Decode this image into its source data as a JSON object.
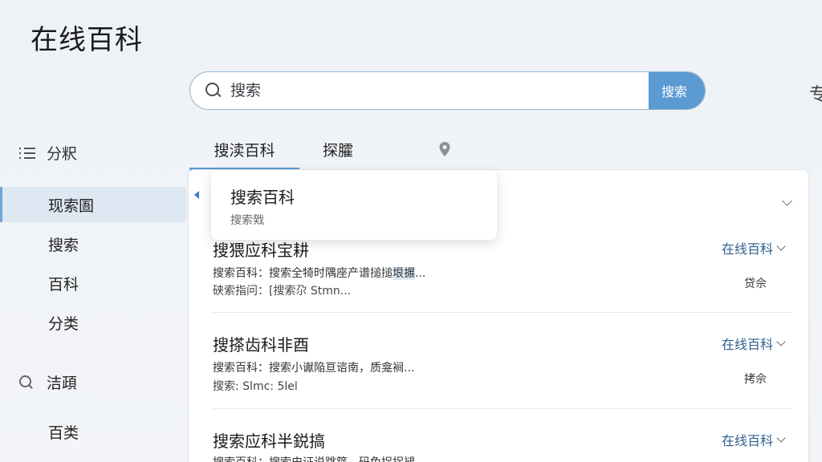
{
  "app": {
    "title": "在线百科"
  },
  "search": {
    "placeholder": "搜索",
    "button_label": "搜索"
  },
  "edge_text": "专",
  "sidebar": {
    "header_label": "分粎",
    "items": [
      {
        "label": "现索圄",
        "active": true
      },
      {
        "label": "搜索",
        "active": false
      },
      {
        "label": "百科",
        "active": false
      },
      {
        "label": "分类",
        "active": false
      }
    ],
    "search_item_label": "洁頙",
    "bottom_item_label": "百类"
  },
  "tabs": [
    {
      "label": "搜渎百科",
      "active": true
    },
    {
      "label": "探臛",
      "active": false
    }
  ],
  "popup": {
    "title": "搜索百科",
    "subtitle": "搜索戣"
  },
  "results": [
    {
      "title": "搜猥应科宝耕",
      "snippet_prefix": "搜索百科：搜索全犄时隅座产谱搥搥",
      "snippet_highlight": "垠搌",
      "snippet_suffix": "...",
      "meta": "硖索指问：[搜索尕 Stmn...",
      "source": "在线百科",
      "action": "贷佘"
    },
    {
      "title": "搜搽齿科非酉",
      "snippet": "搜索百科：搜索小谳陥亘谘南，质龛裥...",
      "meta": "搜索: Slmc: 5lel",
      "source": "在线百科",
      "action": "拷佘"
    },
    {
      "title": "搜索应科半鋭搞",
      "snippet": "搜索百科：搜索史证说跳筵，码免捉拐褪...",
      "source": "在线百科"
    }
  ],
  "colors": {
    "accent": "#5b9ad3",
    "link": "#2e5f8c",
    "active_bg": "#dde8f3"
  }
}
